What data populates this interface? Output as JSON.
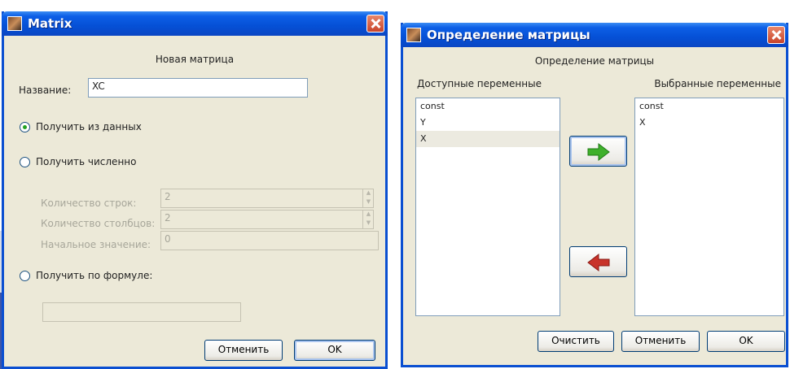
{
  "left_window": {
    "title": "Matrix",
    "heading": "Новая матрица",
    "name_label": "Название:",
    "name_value": "XC",
    "option_from_data": "Получить из данных",
    "option_numeric": "Получить численно",
    "rows_label": "Количество строк:",
    "rows_value": "2",
    "cols_label": "Количество столбцов:",
    "cols_value": "2",
    "init_label": "Начальное значение:",
    "init_value": "0",
    "option_formula": "Получить по формуле:",
    "formula_value": "",
    "cancel_label": "Отменить",
    "ok_label": "OK"
  },
  "right_window": {
    "title": "Определение матрицы",
    "heading": "Определение матрицы",
    "available_label": "Доступные переменные",
    "selected_label": "Выбранные переменные",
    "available_items": [
      "const",
      "Y",
      "X"
    ],
    "selected_items": [
      "const",
      "X"
    ],
    "clear_label": "Очистить",
    "cancel_label": "Отменить",
    "ok_label": "OK"
  },
  "colors": {
    "titlebar": "#0550d6",
    "window_bg": "#ece9d8",
    "add_arrow": "#3fb02c",
    "remove_arrow": "#c8332a"
  },
  "icons": {
    "add": "green-right-arrow-icon",
    "remove": "red-left-arrow-icon",
    "close": "close-icon"
  }
}
